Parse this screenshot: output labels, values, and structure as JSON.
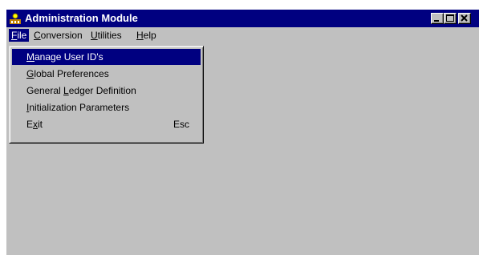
{
  "window": {
    "title": "Administration Module",
    "controls": [
      "minimize-icon",
      "maximize-icon",
      "close-icon"
    ]
  },
  "menubar": {
    "items": [
      {
        "label": "File",
        "accel": "F",
        "rest": "ile",
        "active": true
      },
      {
        "label": "Conversion",
        "accel": "C",
        "rest": "onversion"
      },
      {
        "label": "Utilities",
        "accel": "U",
        "rest": "tilities"
      },
      {
        "label": "Help",
        "accel": "H",
        "rest": "elp"
      }
    ]
  },
  "file_menu": {
    "items": [
      {
        "label": "Manage User ID's",
        "pre": "",
        "accel": "M",
        "post": "anage User ID's",
        "selected": true
      },
      {
        "label": "Global Preferences",
        "pre": "",
        "accel": "G",
        "post": "lobal Preferences"
      },
      {
        "label": "General Ledger Definition",
        "pre": "General ",
        "accel": "L",
        "post": "edger Definition"
      },
      {
        "label": "Initialization Parameters",
        "pre": "",
        "accel": "I",
        "post": "nitialization Parameters"
      },
      {
        "label": "Exit",
        "pre": "E",
        "accel": "x",
        "post": "it",
        "shortcut": "Esc"
      }
    ]
  },
  "colors": {
    "titlebar": "#000080",
    "selection": "#000080",
    "face": "#c0c0c0"
  }
}
